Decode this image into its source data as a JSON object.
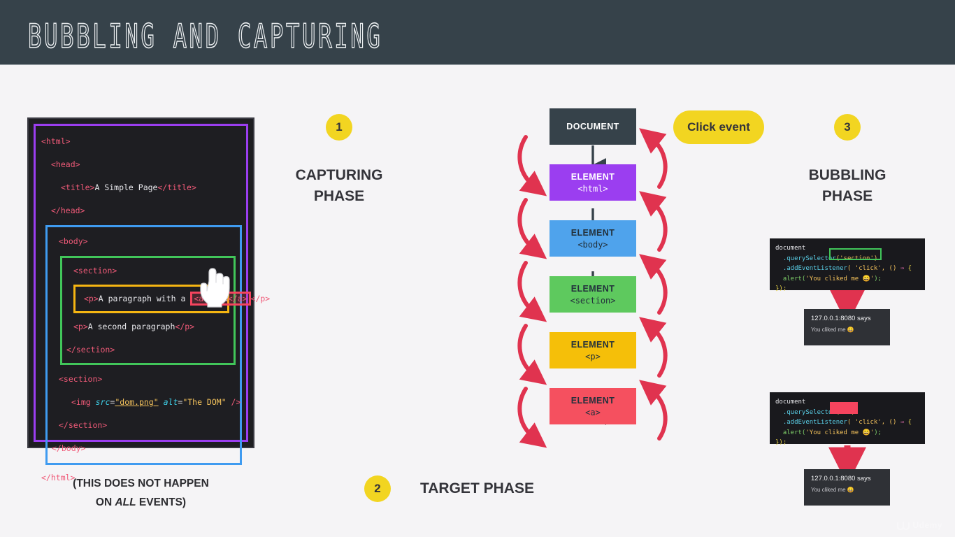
{
  "header": {
    "title": "BUBBLING AND CAPTURING"
  },
  "code_panel": {
    "lines": [
      "<html>",
      "<head>",
      "<title>A Simple Page</title>",
      "</head>",
      "<body>",
      "<section>",
      "<p>A paragraph with a <a>link</a></p>",
      "<p>A second paragraph</p>",
      "</section>",
      "<section>",
      "<img src=\"dom.png\" alt=\"The DOM\" />",
      "</section>",
      "</body>",
      "</html>"
    ],
    "tokens": {
      "html_open": "<html>",
      "head_open": "<head>",
      "title_open": "<title>",
      "title_text": "A Simple Page",
      "title_close": "</title>",
      "head_close": "</head>",
      "body_open": "<body>",
      "section_open": "<section>",
      "p_open": "<p>",
      "p_text": "A paragraph with a ",
      "a_open": "<a>",
      "a_text": "link",
      "a_close": "</a>",
      "p_close": "</p>",
      "p2_open": "<p>",
      "p2_text": "A second paragraph",
      "p2_close": "</p>",
      "section_close": "</section>",
      "section2_open": "<section>",
      "img_tag": "<img ",
      "img_src_attr": "src",
      "img_src_val": "\"dom.png\"",
      "img_alt_attr": "alt",
      "img_alt_val": "\"The DOM\"",
      "img_selfclose": " />",
      "section2_close": "</section>",
      "body_close": "</body>",
      "html_close": "</html>",
      "eq": "="
    },
    "nesting_colors": {
      "html": "#9b3ef0",
      "body": "#3f9bf0",
      "section": "#41c65a",
      "p": "#f5b512",
      "a": "#f5445e"
    },
    "caption_line1": "(THIS DOES NOT HAPPEN",
    "caption_line2_pre": "ON ",
    "caption_line2_em": "ALL",
    "caption_line2_post": " EVENTS)"
  },
  "phases": {
    "capturing": {
      "number": "1",
      "title_line1": "CAPTURING",
      "title_line2": "PHASE"
    },
    "target": {
      "number": "2",
      "title": "TARGET PHASE"
    },
    "bubbling": {
      "number": "3",
      "title_line1": "BUBBLING",
      "title_line2": "PHASE"
    }
  },
  "click_event": {
    "label": "Click event",
    "color": "#f2d521"
  },
  "flow": {
    "nodes": [
      {
        "kind": "DOCUMENT",
        "tag": "",
        "color": "#36424a",
        "text_color": "#ffffff"
      },
      {
        "kind": "ELEMENT",
        "tag": "<html>",
        "color": "#9b3ef0",
        "text_color": "#ffffff"
      },
      {
        "kind": "ELEMENT",
        "tag": "<body>",
        "color": "#4fa3ec",
        "text_color": "#23313c"
      },
      {
        "kind": "ELEMENT",
        "tag": "<section>",
        "color": "#5ec95e",
        "text_color": "#23313c"
      },
      {
        "kind": "ELEMENT",
        "tag": "<p>",
        "color": "#f5bf09",
        "text_color": "#23313c"
      },
      {
        "kind": "ELEMENT",
        "tag": "<a>",
        "color": "#f5505f",
        "text_color": "#23313c"
      }
    ],
    "capture_arrow_color": "#e0334f",
    "bubble_arrow_color": "#e0334f",
    "down_arrow_color": "#36424a"
  },
  "snippets": [
    {
      "name": "section-listener",
      "line1": "document",
      "line2_prop": "  .querySelector",
      "line2_arg": "('section')",
      "line3_prop": "  .addEventListener",
      "line3_arg": "( 'click', () ",
      "line3_arrow": "⇒",
      "line3_brace": " {",
      "line4_fn": "  alert(",
      "line4_str": "'You cliked me 😄'",
      "line4_end": ");",
      "line5": "});",
      "highlight": "('section')",
      "highlight_color": "#41c65a"
    },
    {
      "name": "a-listener",
      "line1": "document",
      "line2_prop": "  .querySelector",
      "line2_arg": "('a')",
      "line3_prop": "  .addEventListener",
      "line3_arg": "( 'click', () ",
      "line3_arrow": "⇒",
      "line3_brace": " {",
      "line4_fn": "  alert(",
      "line4_str": "'You cliked me 😄'",
      "line4_end": ");",
      "line5": "});",
      "highlight": "('a')",
      "highlight_color": "#f5445e"
    }
  ],
  "alerts": [
    {
      "title": "127.0.0.1:8080 says",
      "message": "You cliked me 😄"
    },
    {
      "title": "127.0.0.1:8080 says",
      "message": "You cliked me 😄"
    }
  ],
  "watermark": {
    "text": "Udemy"
  }
}
